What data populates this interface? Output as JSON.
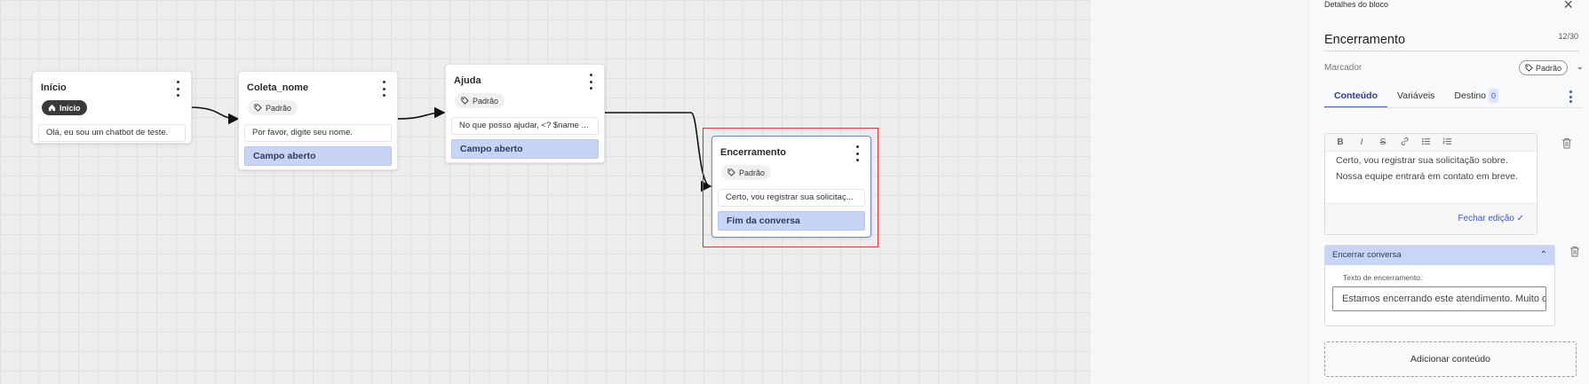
{
  "canvas": {
    "nodes": [
      {
        "title": "Início",
        "tag": "Início",
        "text": "Olá, eu sou um chatbot de teste.",
        "option": ""
      },
      {
        "title": "Coleta_nome",
        "tag": "Padrão",
        "text": "Por favor, digite seu nome.",
        "option": "Campo aberto"
      },
      {
        "title": "Ajuda",
        "tag": "Padrão",
        "text": "No que posso ajudar, <? $name ...",
        "option": "Campo aberto"
      },
      {
        "title": "Encerramento",
        "tag": "Padrão",
        "text": "Certo, vou registrar sua solicitaç...",
        "option": "Fim da conversa"
      }
    ]
  },
  "panel": {
    "header": "Detalhes do bloco",
    "block_name": "Encerramento",
    "counter": "12/30",
    "marker_label": "Marcador",
    "marker_tag": "Padrão",
    "tabs": [
      {
        "label": "Conteúdo"
      },
      {
        "label": "Variáveis"
      },
      {
        "label": "Destino",
        "badge": "0"
      }
    ],
    "toolbar": {
      "bold": "B",
      "italic": "I",
      "strike": "S"
    },
    "editor_text": "Certo, vou registrar sua solicitação sobre. Nossa equipe entrará em contato em breve.",
    "close_edit": "Fechar edição ✓",
    "end_card": {
      "title": "Encerrar conversa",
      "field_label": "Texto de encerramento:",
      "field_value": "Estamos encerrando este atendimento. Muito obrigado!"
    },
    "add_content": "Adicionar conteúdo"
  },
  "colors": {
    "accent": "#3b5bcc",
    "option_bg": "#c6d4f6",
    "selection": "#e0303a"
  }
}
